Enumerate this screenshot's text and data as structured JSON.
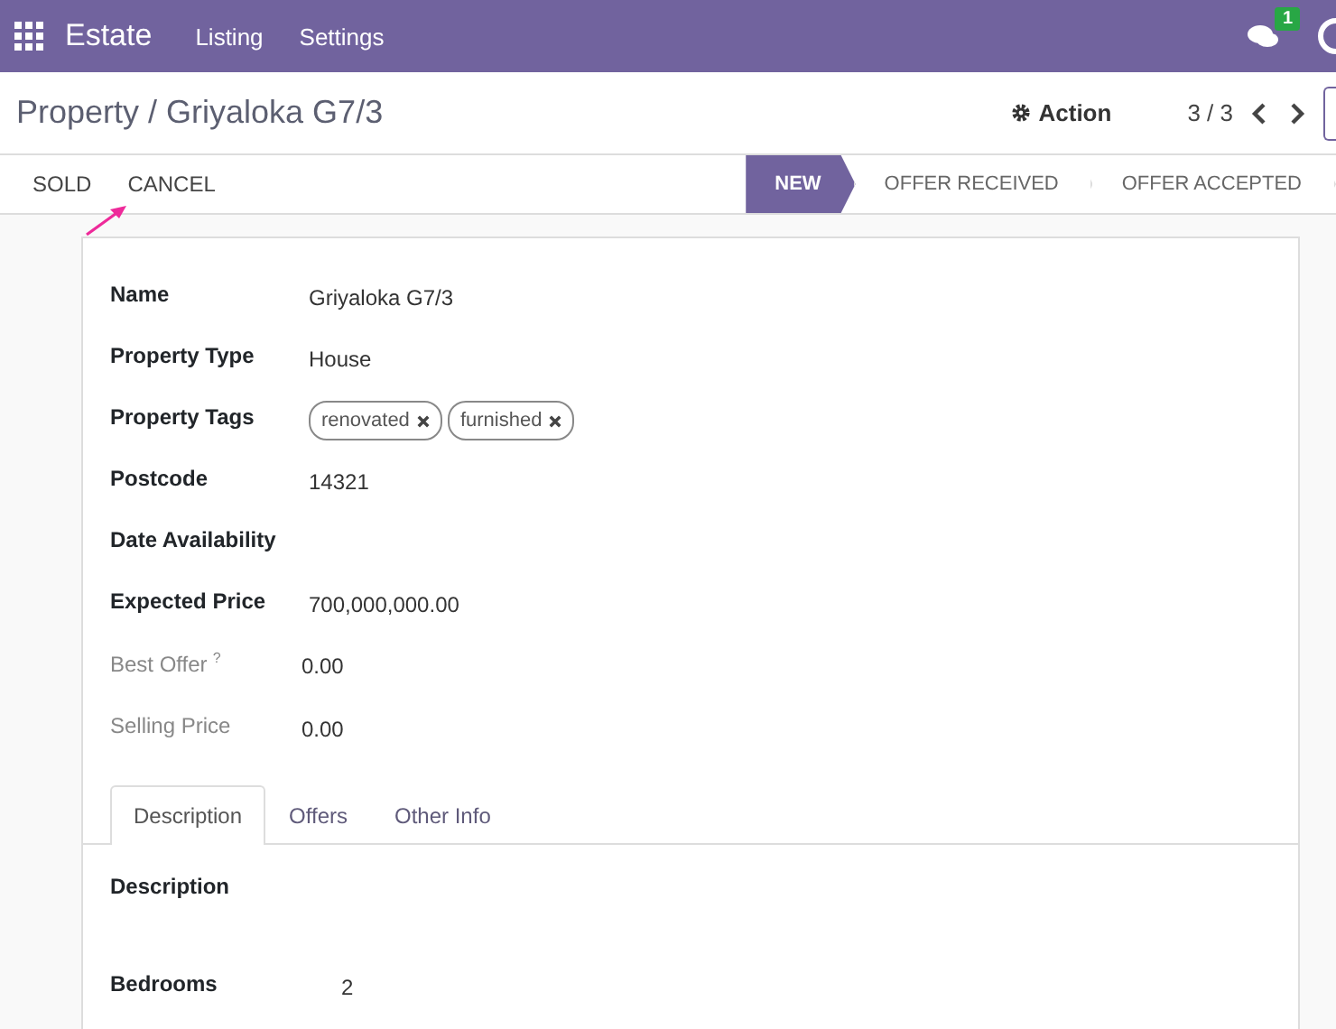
{
  "navbar": {
    "app": "Estate",
    "menus": [
      "Listing",
      "Settings"
    ],
    "chat_badge": "1"
  },
  "control_panel": {
    "breadcrumb": "Property / Griyaloka G7/3",
    "action": "Action",
    "pager": "3 / 3"
  },
  "header": {
    "buttons": [
      "SOLD",
      "CANCEL"
    ],
    "stages": [
      {
        "label": "NEW",
        "selected": true
      },
      {
        "label": "OFFER RECEIVED",
        "selected": false
      },
      {
        "label": "OFFER ACCEPTED",
        "selected": false
      }
    ]
  },
  "fields": [
    {
      "label": "Name",
      "kind": "text",
      "value": "Griyaloka G7/3",
      "readonly": false
    },
    {
      "label": "Property Type",
      "kind": "text",
      "value": "House",
      "readonly": false
    },
    {
      "label": "Property Tags",
      "kind": "tags",
      "tags": [
        "renovated",
        "furnished"
      ],
      "readonly": false
    },
    {
      "label": "Postcode",
      "kind": "text",
      "value": "14321",
      "readonly": false
    },
    {
      "label": "Date Availability",
      "kind": "empty",
      "readonly": false
    },
    {
      "label": "Expected Price",
      "kind": "text",
      "value": "700,000,000.00",
      "readonly": false
    },
    {
      "label": "Best Offer",
      "help_mark": "?",
      "kind": "text",
      "value": "0.00",
      "readonly": true
    },
    {
      "label": "Selling Price",
      "kind": "text",
      "value": "0.00",
      "readonly": true
    }
  ],
  "tabs": [
    {
      "label": "Description",
      "selected": true
    },
    {
      "label": "Offers",
      "selected": false
    },
    {
      "label": "Other Info",
      "selected": false
    }
  ],
  "tab_content": {
    "section": "Description",
    "fields": [
      {
        "label": "Bedrooms",
        "value": "2"
      }
    ]
  }
}
